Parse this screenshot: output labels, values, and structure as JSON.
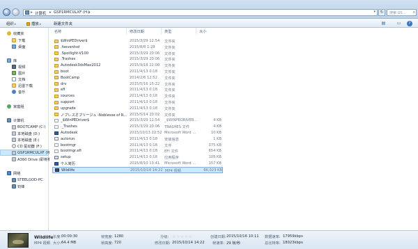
{
  "address": {
    "crumbs": [
      "计算机",
      "GSP1RMCULXF (H:)"
    ],
    "search_placeholder": "搜索 GS..."
  },
  "toolbar": {
    "organize": "组织",
    "play": "播放",
    "new_folder": "新建文件夹"
  },
  "nav": {
    "favorites": "收藏夹",
    "downloads": "下载",
    "desktop": "桌面",
    "libraries": "库",
    "videos": "视频",
    "pictures": "图片",
    "documents": "文档",
    "thunder": "迅雷下载",
    "music": "音乐",
    "homegroup": "家庭组",
    "computer": "计算机",
    "drive_c": "BOOTCAMP (C:)",
    "drive_d": "本地磁盘 (D:)",
    "drive_e": "本地磁盘 (E:)",
    "drive_f": "CD 驱动器 (F:)",
    "drive_h": "GSP1RMCULXF (H:)",
    "drive_i": "A360 Drive (即将推",
    "network": "网络",
    "net_1": "STEELGOD-PC",
    "net_2": "钧锋"
  },
  "columns": {
    "name": "名称",
    "date": "修改日期",
    "type": "类型",
    "size": "大小"
  },
  "files": [
    {
      "name": "$WinPEDriver$",
      "date": "2015/3/29 12:54",
      "type": "文件夹",
      "size": "",
      "kind": "fold"
    },
    {
      "name": ".fseventsd",
      "date": "2015/8/8 1:28",
      "type": "文件夹",
      "size": "",
      "kind": "fold"
    },
    {
      "name": ".Spotlight-V100",
      "date": "2015/3/29 20:06",
      "type": "文件夹",
      "size": "",
      "kind": "fold"
    },
    {
      "name": ".Trashes",
      "date": "2015/3/29 20:06",
      "type": "文件夹",
      "size": "",
      "kind": "fold"
    },
    {
      "name": "Autodesk3dsMax2012",
      "date": "2015/9/18 22:08",
      "type": "文件夹",
      "size": "",
      "kind": "fold"
    },
    {
      "name": "boot",
      "date": "2011/4/13 0:18",
      "type": "文件夹",
      "size": "",
      "kind": "fold"
    },
    {
      "name": "BootCamp",
      "date": "2014/2/6 12:52",
      "type": "文件夹",
      "size": "",
      "kind": "fold"
    },
    {
      "name": "drv",
      "date": "2015/5/16 15:22",
      "type": "文件夹",
      "size": "",
      "kind": "fold"
    },
    {
      "name": "efi",
      "date": "2011/4/13 0:18",
      "type": "文件夹",
      "size": "",
      "kind": "fold"
    },
    {
      "name": "sources",
      "date": "2011/4/13 0:18",
      "type": "文件夹",
      "size": "",
      "kind": "fold"
    },
    {
      "name": "support",
      "date": "2011/4/13 0:18",
      "type": "文件夹",
      "size": "",
      "kind": "fold"
    },
    {
      "name": "upgrade",
      "date": "2011/4/13 0:18",
      "type": "文件夹",
      "size": "",
      "kind": "fold"
    },
    {
      "name": "ノブレスオブリージュ -Noblesse of R...",
      "date": "2015/5/14 20:02",
      "type": "文件夹",
      "size": "",
      "kind": "fold"
    },
    {
      "name": "_$WinPEDriver$",
      "date": "2015/3/29 12:54",
      "type": "_$WINPEDRIVER...",
      "size": "4 KB",
      "kind": "file"
    },
    {
      "name": "._Trashes",
      "date": "2015/3/29 20:06",
      "type": "TRASHES 文件",
      "size": "4 KB",
      "kind": "file"
    },
    {
      "name": "Autodesk",
      "date": "2015/10/13 22:52",
      "type": "Microsoft Word ...",
      "size": "10 KB",
      "kind": "word"
    },
    {
      "name": "autorun",
      "date": "2011/4/13 0:18",
      "type": "安装信息",
      "size": "1 KB",
      "kind": "sys"
    },
    {
      "name": "bootmgr",
      "date": "2011/4/13 0:18",
      "type": "文件",
      "size": "375 KB",
      "kind": "file"
    },
    {
      "name": "bootmgr.efi",
      "date": "2011/4/13 0:18",
      "type": "EFI 文件",
      "size": "654 KB",
      "kind": "file"
    },
    {
      "name": "setup",
      "date": "2011/4/13 0:18",
      "type": "应用程序",
      "size": "105 KB",
      "kind": "app"
    },
    {
      "name": "个人简历",
      "date": "2015/8/10 13:41",
      "type": "Microsoft Word ...",
      "size": "157 KB",
      "kind": "word"
    },
    {
      "name": "Wildlife",
      "date": "2015/10/14 14:22",
      "type": "MP4 视频",
      "size": "66,023 KB",
      "kind": "vid"
    }
  ],
  "details": {
    "title": "Wildlife",
    "subtitle": "MP4 视频",
    "length_label": "长度:",
    "length": "00:00:30",
    "size_label": "大小:",
    "size": "64.4 MB",
    "width_label": "帧宽度:",
    "width": "1280",
    "height_label": "帧高度:",
    "height": "720",
    "rating_label": "分级:",
    "rating_stars": "☆☆☆☆☆",
    "modified_label": "修改日期:",
    "modified": "2015/10/14 14:22",
    "created_label": "创建日期:",
    "created": "2015/10/16 10:11",
    "framerate_label": "帧速率:",
    "framerate": "29 帧/秒",
    "datarate_label": "数据速率:",
    "datarate": "17959kbps",
    "totalbit_label": "总比特率:",
    "totalbit": "18023kbps"
  }
}
